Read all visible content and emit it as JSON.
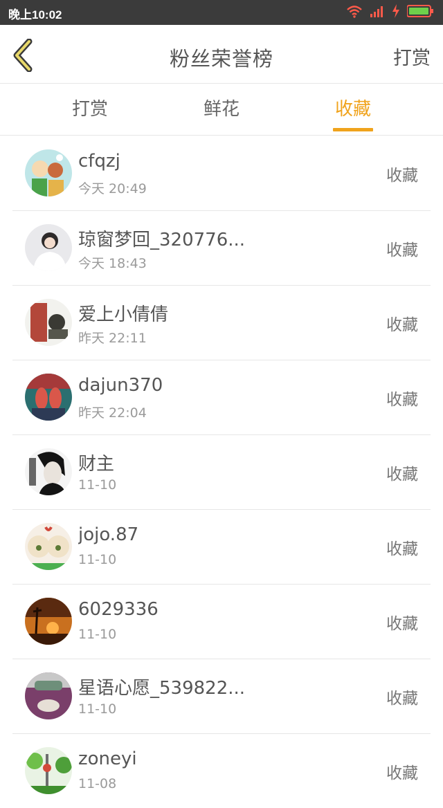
{
  "status_bar": {
    "time": "晚上10:02",
    "icons": [
      "wifi-icon",
      "signal-icon",
      "charging-icon",
      "battery-icon"
    ]
  },
  "header": {
    "title": "粉丝荣誉榜",
    "right_action": "打赏",
    "back_icon": "chevron-left-icon"
  },
  "tabs": [
    {
      "label": "打赏",
      "active": false
    },
    {
      "label": "鲜花",
      "active": false
    },
    {
      "label": "收藏",
      "active": true
    }
  ],
  "colors": {
    "accent": "#f0a31c",
    "status_bar_bg": "#3b3b3b",
    "divider": "#e6e6e6",
    "text_primary": "#555555",
    "text_secondary": "#9a9a9a"
  },
  "fans": [
    {
      "name": "cfqzj",
      "time": "今天 20:49",
      "action": "收藏"
    },
    {
      "name": "琼窗梦回_320776...",
      "time": "今天 18:43",
      "action": "收藏"
    },
    {
      "name": "爱上小倩倩",
      "time": "昨天 22:11",
      "action": "收藏"
    },
    {
      "name": "dajun370",
      "time": "昨天 22:04",
      "action": "收藏"
    },
    {
      "name": "财主",
      "time": "11-10",
      "action": "收藏"
    },
    {
      "name": "jojo.87",
      "time": "11-10",
      "action": "收藏"
    },
    {
      "name": "6029336",
      "time": "11-10",
      "action": "收藏"
    },
    {
      "name": "星语心愿_539822...",
      "time": "11-10",
      "action": "收藏"
    },
    {
      "name": "zoneyi",
      "time": "11-08",
      "action": "收藏"
    }
  ]
}
